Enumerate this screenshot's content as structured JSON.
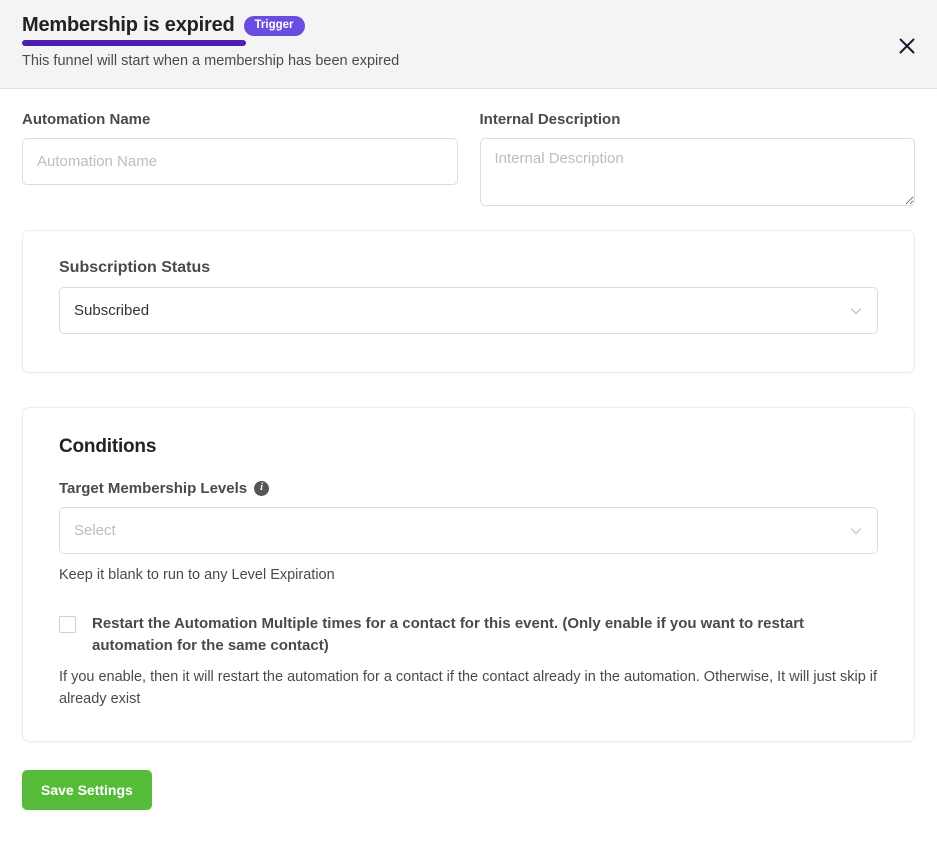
{
  "header": {
    "title": "Membership is expired",
    "badge": "Trigger",
    "subtitle": "This funnel will start when a membership has been expired",
    "close_icon": "close-icon",
    "accent_color": "#4c1fb0",
    "badge_color": "#6b4ce0"
  },
  "form": {
    "automation_name": {
      "label": "Automation Name",
      "placeholder": "Automation Name",
      "value": ""
    },
    "internal_description": {
      "label": "Internal Description",
      "placeholder": "Internal Description",
      "value": ""
    }
  },
  "subscription_card": {
    "label": "Subscription Status",
    "select": {
      "value": "Subscribed",
      "icon": "chevron-down-icon"
    }
  },
  "conditions_card": {
    "title": "Conditions",
    "target_levels": {
      "label": "Target Membership Levels",
      "info_icon": "info-icon",
      "placeholder": "Select",
      "value": "",
      "chevron_icon": "chevron-down-icon",
      "helper": "Keep it blank to run to any Level Expiration"
    },
    "restart_checkbox": {
      "checked": false,
      "label": "Restart the Automation Multiple times for a contact for this event. (Only enable if you want to restart automation for the same contact)",
      "note": "If you enable, then it will restart the automation for a contact if the contact already in the automation. Otherwise, It will just skip if already exist"
    }
  },
  "footer": {
    "save_label": "Save Settings",
    "save_color": "#57bb3a"
  }
}
